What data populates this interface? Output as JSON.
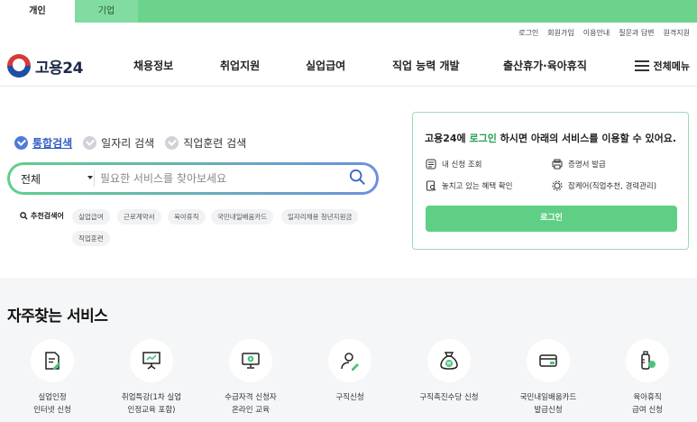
{
  "top_tabs": [
    {
      "label": "개인",
      "active": true
    },
    {
      "label": "기업",
      "active": false
    }
  ],
  "util_links": [
    "로그인",
    "회원가입",
    "이용안내",
    "질문과 답변",
    "원격지원"
  ],
  "logo": {
    "text": "고용24"
  },
  "gnb": [
    "채용정보",
    "취업지원",
    "실업급여",
    "직업 능력 개발",
    "출산휴가·육아휴직"
  ],
  "all_menu_label": "전체메뉴",
  "search": {
    "tabs": [
      {
        "label": "통합검색",
        "active": true
      },
      {
        "label": "일자리 검색",
        "active": false
      },
      {
        "label": "직업훈련 검색",
        "active": false
      }
    ],
    "category": "전체",
    "placeholder": "필요한 서비스를 찾아보세요"
  },
  "recommend": {
    "title": "추천검색어",
    "keywords": [
      "실업급여",
      "근로계약서",
      "육아휴직",
      "국민내일배움카드",
      "일자리채용 청년지원금",
      "직업훈련"
    ]
  },
  "login_card": {
    "title_prefix": "고용24에 ",
    "title_highlight": "로그인",
    "title_suffix": " 하시면 아래의 서비스를 이용할 수 있어요.",
    "items": [
      "내 신청 조회",
      "증명서 발급",
      "놓치고 있는 혜택 확인",
      "잡케어(직업추천, 경력관리)"
    ],
    "button": "로그인"
  },
  "services": {
    "title": "자주찾는 서비스",
    "items": [
      {
        "line1": "실업인정",
        "line2": "인터넷 신청",
        "icon": "document-pen-icon"
      },
      {
        "line1": "취업특강(1차 실업",
        "line2": "인정교육 포함)",
        "icon": "presentation-board-icon"
      },
      {
        "line1": "수급자격 신청자",
        "line2": "온라인 교육",
        "icon": "monitor-play-icon"
      },
      {
        "line1": "구직신청",
        "line2": "",
        "icon": "person-pen-icon"
      },
      {
        "line1": "구직촉진수당 신청",
        "line2": "",
        "icon": "money-bag-icon"
      },
      {
        "line1": "국민내일배움카드",
        "line2": "발급신청",
        "icon": "card-icon"
      },
      {
        "line1": "육아휴직",
        "line2": "급여 신청",
        "icon": "baby-bottle-icon"
      }
    ]
  },
  "colors": {
    "brand_green": "#6bd38c",
    "button_green": "#5fcf86",
    "link_blue": "#2f5cc2"
  }
}
